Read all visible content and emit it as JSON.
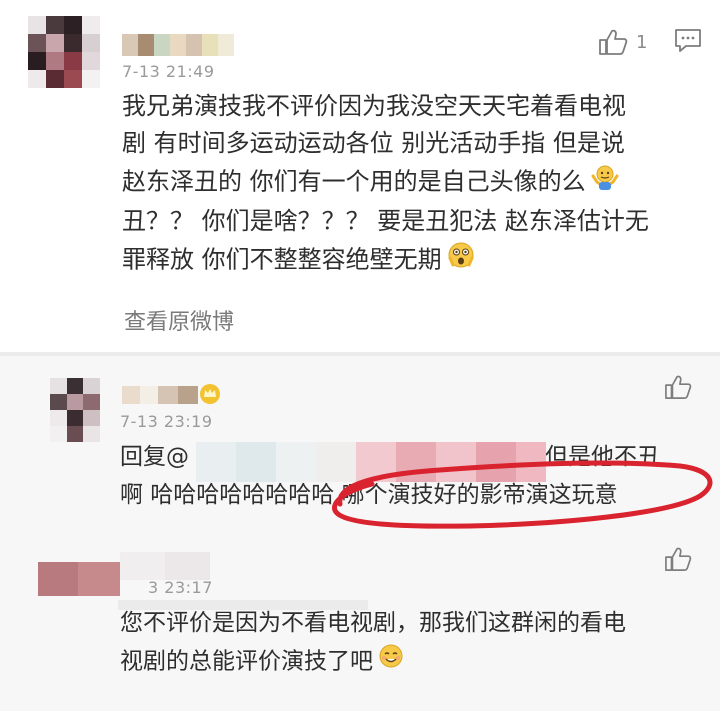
{
  "comment1": {
    "time": "7-13 21:49",
    "like_count": "1",
    "lines": [
      "我兄弟演技我不评价因为我没空天天宅着看电视",
      "剧 有时间多运动运动各位 别光活动手指 但是说",
      "赵东泽丑的 你们有一个用的是自己头像的么",
      "丑？？ 你们是啥？？？ 要是丑犯法 赵东泽估计无",
      "罪释放 你们不整整容绝壁无期"
    ],
    "view_original": "查看原微博",
    "emoji1": "shrugging-emoji",
    "emoji2": "shocked-emoji"
  },
  "reply1": {
    "time": "7-13 23:19",
    "line1_start": "回复@",
    "line1_end": "但是他不丑",
    "line2_start": "啊 哈哈哈哈哈哈哈哈 ",
    "line2_highlight": "哪个演技好的影帝演这玩意",
    "badge_icon": "crown-badge-icon"
  },
  "reply2": {
    "time": "3 23:17",
    "lines": [
      "您不评价是因为不看电视剧，那我们这群闲的看电",
      "视剧的总能评价演技了吧"
    ],
    "emoji": "smiling-emoji"
  },
  "colors": {
    "annotation_red": "#d9232e",
    "text": "#2e2e2e",
    "muted": "#9a9a9a"
  }
}
